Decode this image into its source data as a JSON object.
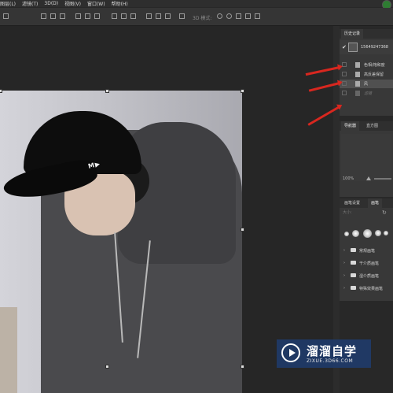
{
  "menu": {
    "items": [
      "图层(L)",
      "滤镜(T)",
      "3D(D)",
      "视图(V)",
      "窗口(W)",
      "帮助(H)"
    ]
  },
  "options": {
    "mode_3d_label": "3D 模式:"
  },
  "history": {
    "tabs": [
      "历史记录"
    ],
    "snapshot_name": "15649247368",
    "steps": [
      {
        "label": "色相/饱和度",
        "state": "normal"
      },
      {
        "label": "高反差保留",
        "state": "normal"
      },
      {
        "label": "风",
        "state": "selected"
      },
      {
        "label": "滤镜",
        "state": "dimmed"
      }
    ]
  },
  "navigator": {
    "tabs": [
      "导航器",
      "直方图"
    ],
    "zoom": "100%"
  },
  "brush": {
    "tabs": [
      "画笔设置",
      "画笔"
    ],
    "size_label": "大小:",
    "groups": [
      "常规画笔",
      "干介质画笔",
      "湿介质画笔",
      "特殊效果画笔"
    ]
  },
  "watermark": {
    "name": "溜溜自学",
    "url": "ZIXUE.3D66.COM"
  },
  "photo": {
    "cap_logo": "M▶"
  },
  "colors": {
    "arrow": "#d8271f",
    "accent_avatar": "#2e7d32",
    "watermark_bg": "#1e3c6e"
  }
}
